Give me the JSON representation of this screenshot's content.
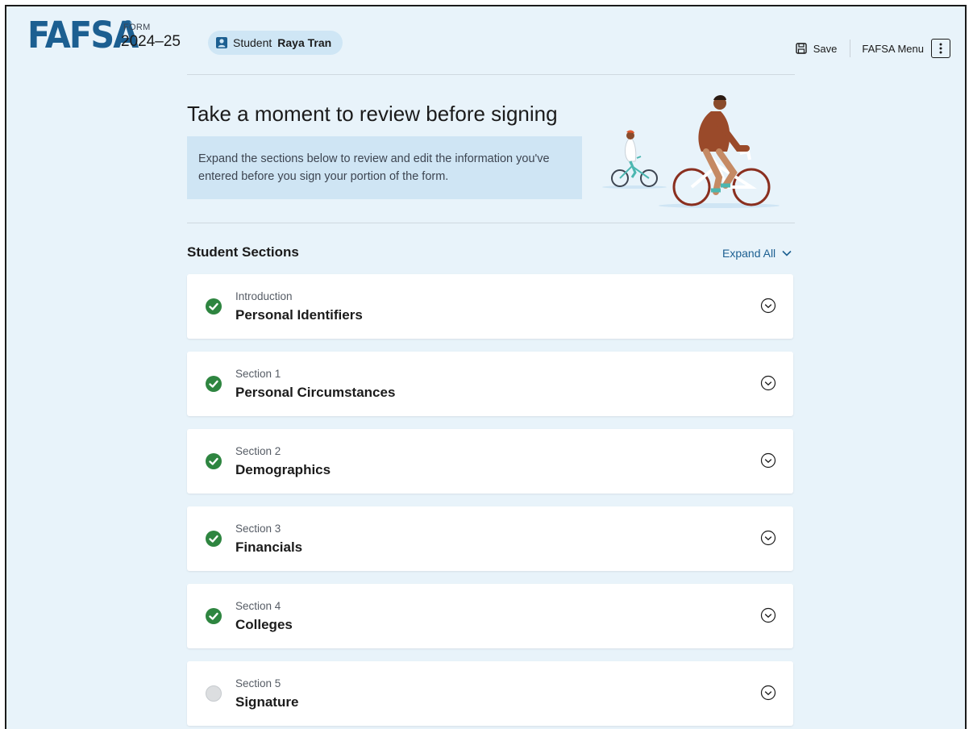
{
  "header": {
    "logo_text": "FAFSA",
    "logo_reg": "®",
    "form_label": "FORM",
    "form_year": "2024–25",
    "student_prefix": "Student",
    "student_name": "Raya Tran",
    "save_label": "Save",
    "menu_label": "FAFSA Menu"
  },
  "hero": {
    "title": "Take a moment to review before signing",
    "callout": "Expand the sections below to review and edit the information you've entered before you sign your portion of the form."
  },
  "sections": {
    "heading": "Student Sections",
    "expand_all_label": "Expand All",
    "items": [
      {
        "kicker": "Introduction",
        "name": "Personal Identifiers",
        "status": "complete"
      },
      {
        "kicker": "Section 1",
        "name": "Personal Circumstances",
        "status": "complete"
      },
      {
        "kicker": "Section 2",
        "name": "Demographics",
        "status": "complete"
      },
      {
        "kicker": "Section 3",
        "name": "Financials",
        "status": "complete"
      },
      {
        "kicker": "Section 4",
        "name": "Colleges",
        "status": "complete"
      },
      {
        "kicker": "Section 5",
        "name": "Signature",
        "status": "incomplete"
      }
    ]
  },
  "colors": {
    "brand_blue": "#1c5f91",
    "page_bg": "#e8f3fa",
    "complete_green": "#2e8540",
    "incomplete_gray": "#dcdee0"
  }
}
